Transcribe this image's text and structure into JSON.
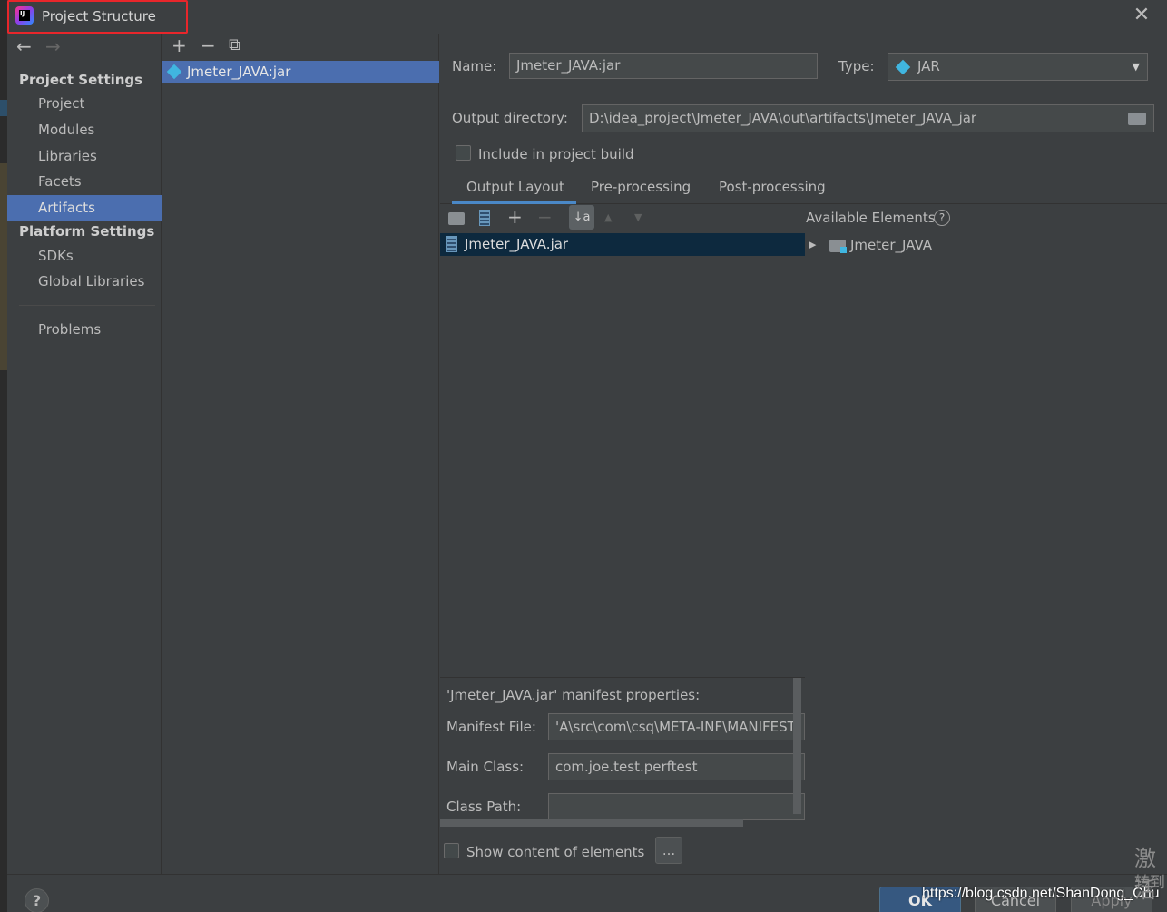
{
  "window": {
    "title": "Project Structure",
    "close_glyph": "✕",
    "app_badge": "IJ"
  },
  "nav": {
    "back_glyph": "←",
    "forward_glyph": "→",
    "project_settings_header": "Project Settings",
    "project_items": [
      "Project",
      "Modules",
      "Libraries",
      "Facets",
      "Artifacts"
    ],
    "selected_item": "Artifacts",
    "platform_settings_header": "Platform Settings",
    "platform_items": [
      "SDKs",
      "Global Libraries"
    ],
    "problems": "Problems"
  },
  "list": {
    "add_glyph": "+",
    "remove_glyph": "−",
    "copy_glyph": "⧉",
    "artifacts": [
      "Jmeter_JAVA:jar"
    ]
  },
  "artifact": {
    "name_label": "Name:",
    "name_value": "Jmeter_JAVA:jar",
    "type_label": "Type:",
    "type_value": "JAR",
    "output_dir_label": "Output directory:",
    "output_dir_value": "D:\\idea_project\\Jmeter_JAVA\\out\\artifacts\\Jmeter_JAVA_jar",
    "include_build_label": "Include in project build",
    "include_build_checked": false
  },
  "tabs": [
    {
      "label": "Output Layout",
      "active": true
    },
    {
      "label": "Pre-processing",
      "active": false
    },
    {
      "label": "Post-processing",
      "active": false
    }
  ],
  "layout": {
    "toolbar": {
      "add_glyph": "+",
      "remove_glyph": "−",
      "sort_glyph": "↓a",
      "up_glyph": "▲",
      "down_glyph": "▼"
    },
    "root_item": "Jmeter_JAVA.jar",
    "available_elements_label": "Available Elements",
    "help_glyph": "?",
    "available_items": [
      "Jmeter_JAVA"
    ],
    "expand_glyph": "▶"
  },
  "manifest": {
    "header": "'Jmeter_JAVA.jar' manifest properties:",
    "manifest_file_label": "Manifest File:",
    "manifest_file_value": "'A\\src\\com\\csq\\META-INF\\MANIFEST.",
    "main_class_label": "Main Class:",
    "main_class_value": "com.joe.test.perftest",
    "class_path_label": "Class Path:",
    "class_path_value": ""
  },
  "show_content_label": "Show content of elements",
  "ellipsis_label": "...",
  "footer": {
    "help_label": "?",
    "ok_label": "OK",
    "cancel_label": "Cancel",
    "apply_label": "Apply"
  },
  "watermark": "https://blog.csdn.net/ShanDong_Chu",
  "overlay_text_1": "激活",
  "overlay_text_2": "转到",
  "colors": {
    "background": "#3c3f41",
    "selection": "#4b6eaf",
    "accent": "#4a88c7",
    "highlight_border": "#e8262b"
  }
}
